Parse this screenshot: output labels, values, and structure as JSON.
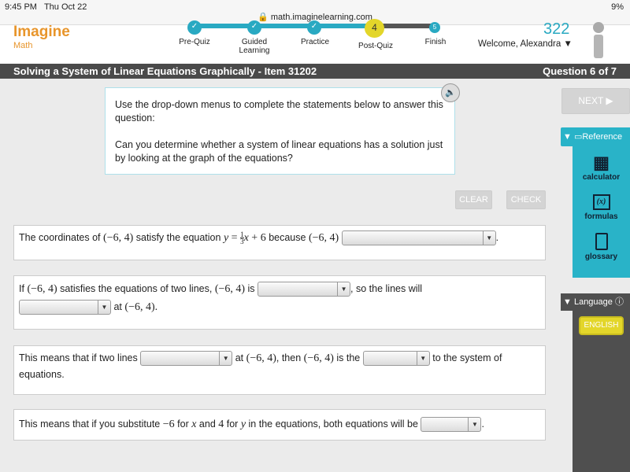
{
  "status_bar": {
    "time": "9:45 PM",
    "date": "Thu Oct 22",
    "battery": "9%",
    "url": "math.imaginelearning.com"
  },
  "header": {
    "logo_main": "Imagine",
    "logo_sub": "Math",
    "score": "322",
    "welcome": "Welcome, Alexandra",
    "steps": [
      {
        "label": "Pre-Quiz",
        "state": "done"
      },
      {
        "label": "Guided Learning",
        "state": "done"
      },
      {
        "label": "Practice",
        "state": "done"
      },
      {
        "label": "Post-Quiz",
        "state": "current",
        "num": "4"
      },
      {
        "label": "Finish",
        "state": "todo",
        "num": "5"
      }
    ]
  },
  "title_bar": {
    "title": "Solving a System of Linear Equations Graphically - Item 31202",
    "question": "Question 6 of 7"
  },
  "question": {
    "p1": "Use the drop-down menus to complete the statements below to answer this question:",
    "p2": "Can you determine whether a system of linear equations has a solution just by looking at the graph of the equations?"
  },
  "buttons": {
    "clear": "CLEAR",
    "check": "CHECK",
    "next": "NEXT ▶"
  },
  "statements": {
    "s1": {
      "a": "The coordinates of",
      "pt": "(−6, 4)",
      "b": "satisfy the equation",
      "eq_y": "y",
      "eq_eq": " = ",
      "num": "1",
      "den": "3",
      "eq_x": "x",
      "eq_rest": " + 6",
      "c": "because",
      "d": "."
    },
    "s2": {
      "a": "If",
      "pt": "(−6, 4)",
      "b": "satisfies the equations of two lines,",
      "c": "is",
      "d": ", so the lines will",
      "e": "at",
      "f": "."
    },
    "s3": {
      "a": "This means that if two lines",
      "b": "at",
      "pt": "(−6, 4)",
      "c": ", then",
      "d": "is the",
      "e": "to the system of equations."
    },
    "s4": {
      "a": "This means that if you substitute",
      "n1": "−6",
      "b": "for",
      "x": "x",
      "c": "and",
      "n2": "4",
      "d": "for",
      "y": "y",
      "e": "in the equations, both equations will be",
      "f": "."
    }
  },
  "reference": {
    "title": "Reference",
    "items": [
      "calculator",
      "formulas",
      "glossary"
    ]
  },
  "language": {
    "title": "Language",
    "button": "ENGLISH"
  },
  "colors": {
    "teal": "#29b3c8",
    "orange": "#e8952b",
    "yellow": "#e3d62a",
    "dark": "#4a4a4a"
  }
}
